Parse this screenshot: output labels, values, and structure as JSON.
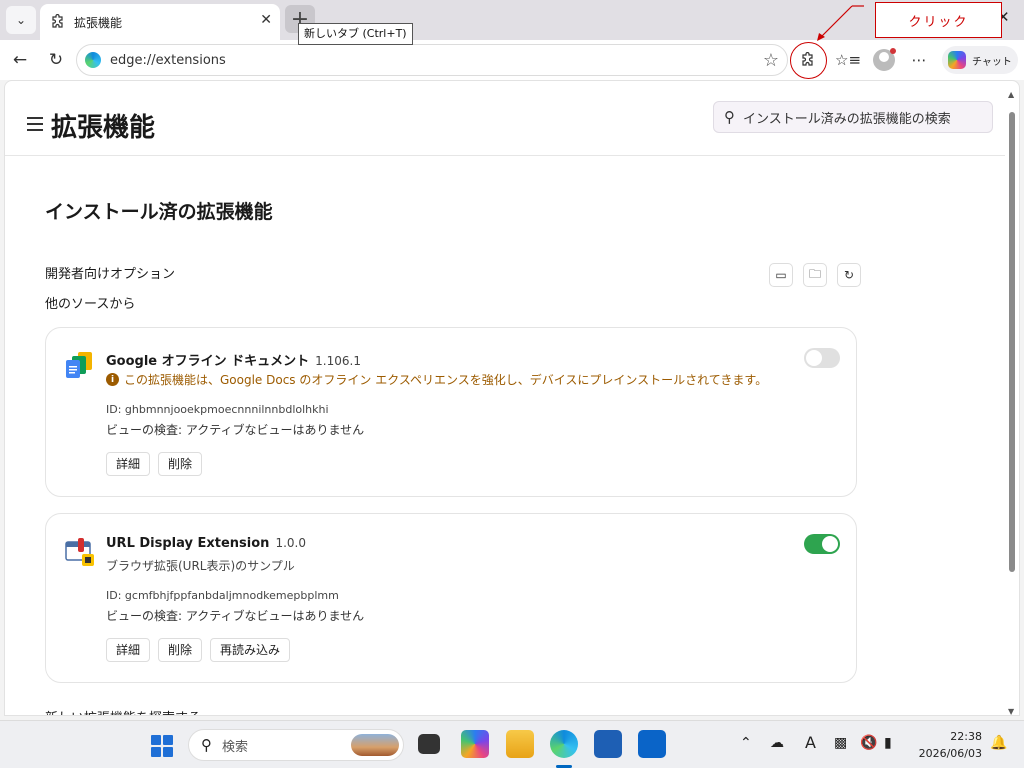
{
  "browser": {
    "tab_title": "拡張機能",
    "tooltip": "新しいタブ (Ctrl+T)",
    "address": "edge://extensions",
    "chat_label": "チャット"
  },
  "annotation": {
    "callout": "クリック",
    "color": "#cc0000"
  },
  "page": {
    "title": "拡張機能",
    "search_placeholder": "インストール済みの拡張機能の検索",
    "section_title": "インストール済の拡張機能",
    "dev_options": "開発者向けオプション",
    "other_sources": "他のソースから",
    "more_heading": "新しい拡張機能を探索する"
  },
  "extensions": [
    {
      "name": "Google オフライン ドキュメント",
      "version": "1.106.1",
      "warning": "この拡張機能は、Google Docs のオフライン エクスペリエンスを強化し、デバイスにプレインストールされてきます。",
      "id": "ID: ghbmnnjooekpmoecnnnilnnbdlolhkhi",
      "inspect": "ビューの検査: アクティブなビューはありません",
      "enabled": false,
      "buttons": [
        "詳細",
        "削除"
      ]
    },
    {
      "name": "URL Display Extension",
      "version": "1.0.0",
      "description": "ブラウザ拡張(URL表示)のサンプル",
      "id": "ID: gcmfbhjfppfanbdaljmnodkemepbplmm",
      "inspect": "ビューの検査: アクティブなビューはありません",
      "enabled": true,
      "buttons": [
        "詳細",
        "削除",
        "再読み込み"
      ]
    }
  ],
  "taskbar": {
    "search_label": "検索",
    "time": "22:38",
    "date": "2026/06/03",
    "ime": "A"
  },
  "colors": {
    "toggle_on": "#2ea44f",
    "warning": "#9c5b00",
    "accent": "#0067c0"
  }
}
